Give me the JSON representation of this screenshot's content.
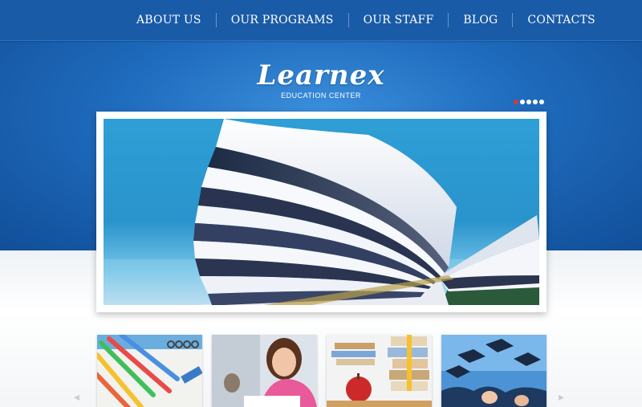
{
  "nav": {
    "items": [
      {
        "label": "ABOUT US"
      },
      {
        "label": "OUR PROGRAMS"
      },
      {
        "label": "OUR STAFF"
      },
      {
        "label": "BLOG"
      },
      {
        "label": "CONTACTS"
      }
    ]
  },
  "brand": {
    "logo": "Learnex",
    "tagline": "EDUCATION CENTER"
  },
  "slider": {
    "slide_count": 5,
    "active_slide": 1,
    "image_subject": "open-book-icon"
  },
  "thumbnails": [
    {
      "subject": "pencils-notebook-icon"
    },
    {
      "subject": "student-girl-icon"
    },
    {
      "subject": "books-apple-icon"
    },
    {
      "subject": "graduation-caps-icon"
    }
  ],
  "colors": {
    "nav_bg": "#1a5ba8",
    "hero_blue": "#1f6bbd",
    "active_dot": "#d23a3a"
  }
}
